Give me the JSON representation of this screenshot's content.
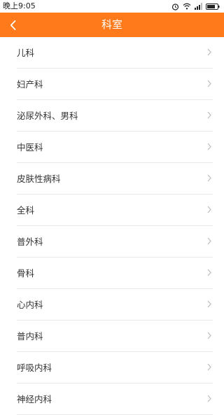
{
  "status_bar": {
    "time": "晚上9:05",
    "icons": [
      "alarm-icon",
      "wifi-icon",
      "signal-icon",
      "battery-icon"
    ]
  },
  "header": {
    "title": "科室",
    "back_icon": "chevron-left-icon",
    "background": "#ff7a1a"
  },
  "departments": [
    {
      "label": "儿科"
    },
    {
      "label": "妇产科"
    },
    {
      "label": "泌尿外科、男科"
    },
    {
      "label": "中医科"
    },
    {
      "label": "皮肤性病科"
    },
    {
      "label": "全科"
    },
    {
      "label": "普外科"
    },
    {
      "label": "骨科"
    },
    {
      "label": "心内科"
    },
    {
      "label": "普内科"
    },
    {
      "label": "呼吸内科"
    },
    {
      "label": "神经内科"
    }
  ]
}
